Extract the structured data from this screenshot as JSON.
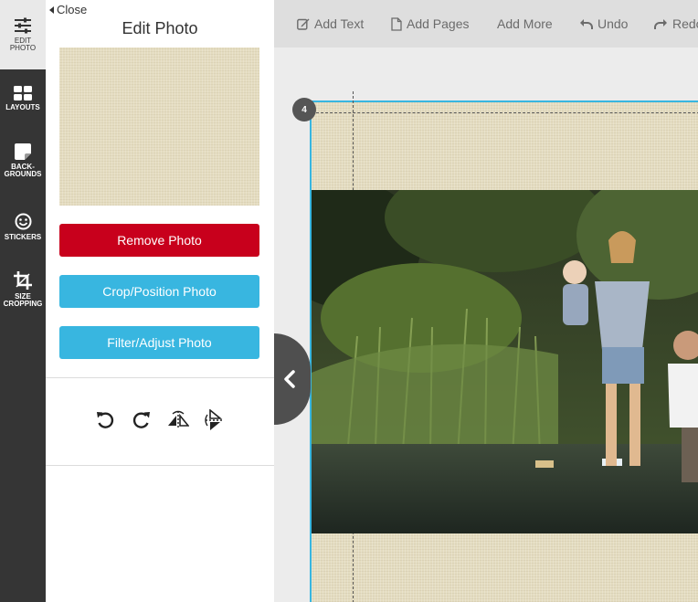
{
  "rail": {
    "items": [
      {
        "label": "EDIT\nPHOTO",
        "icon": "sliders-icon"
      },
      {
        "label": "LAYOUTS",
        "icon": "layouts-grid-icon"
      },
      {
        "label": "BACK-\nGROUNDS",
        "icon": "background-note-icon"
      },
      {
        "label": "STICKERS",
        "icon": "smiley-icon"
      },
      {
        "label": "SIZE\nCROPPING",
        "icon": "crop-icon"
      }
    ]
  },
  "panel": {
    "close_label": "Close",
    "title": "Edit Photo",
    "remove_label": "Remove Photo",
    "crop_label": "Crop/Position Photo",
    "filter_label": "Filter/Adjust Photo",
    "tools": [
      "rotate-left-icon",
      "rotate-right-icon",
      "flip-horizontal-icon",
      "flip-vertical-icon"
    ]
  },
  "toolbar": {
    "add_text": "Add Text",
    "add_pages": "Add Pages",
    "add_more": "Add More",
    "undo": "Undo",
    "redo": "Redo"
  },
  "canvas": {
    "page_number": "4"
  },
  "colors": {
    "rail_bg": "#353535",
    "remove_button": "#c8001c",
    "action_button": "#38b6e0",
    "page_border": "#38b6e0",
    "page_background": "#e4dcc0"
  }
}
